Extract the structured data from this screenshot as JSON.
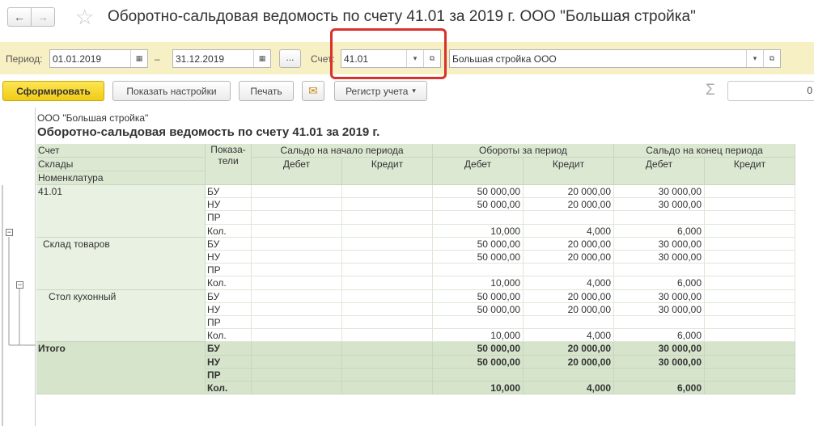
{
  "window": {
    "back_glyph": "←",
    "forward_glyph": "→",
    "favorite_glyph": "☆",
    "title": "Оборотно-сальдовая ведомость по счету 41.01 за 2019 г. ООО \"Большая стройка\""
  },
  "filters": {
    "period_label": "Период:",
    "date_from": "01.01.2019",
    "dash": "–",
    "date_to": "31.12.2019",
    "period_button": "...",
    "account_label": "Счет:",
    "account": "41.01",
    "organization": "Большая стройка ООО",
    "calendar_glyph": "▦",
    "dropdown_glyph": "▾",
    "open_glyph": "⧉"
  },
  "toolbar": {
    "generate": "Сформировать",
    "show_settings": "Показать настройки",
    "print": "Печать",
    "mail_glyph": "✉",
    "register": "Регистр учета",
    "register_arrow": "▾",
    "sigma_glyph": "Σ",
    "sum_value": "0"
  },
  "report": {
    "company": "ООО \"Большая стройка\"",
    "title": "Оборотно-сальдовая ведомость по счету 41.01 за 2019 г.",
    "tree_glyph": "−",
    "headers": {
      "row_labels": [
        "Счет",
        "Склады",
        "Номенклатура"
      ],
      "indicators": "Показа-\nтели",
      "groups": [
        "Сальдо на начало периода",
        "Обороты за период",
        "Сальдо на конец периода"
      ],
      "sub": [
        "Дебет",
        "Кредит",
        "Дебет",
        "Кредит",
        "Дебет",
        "Кредит"
      ]
    },
    "groups": [
      {
        "label": "41.01",
        "level": 0,
        "rows": [
          {
            "ind": "БУ",
            "v": [
              "",
              "",
              "50 000,00",
              "20 000,00",
              "30 000,00",
              ""
            ]
          },
          {
            "ind": "НУ",
            "v": [
              "",
              "",
              "50 000,00",
              "20 000,00",
              "30 000,00",
              ""
            ]
          },
          {
            "ind": "ПР",
            "v": [
              "",
              "",
              "",
              "",
              "",
              ""
            ]
          },
          {
            "ind": "Кол.",
            "v": [
              "",
              "",
              "10,000",
              "4,000",
              "6,000",
              ""
            ]
          }
        ]
      },
      {
        "label": "Склад товаров",
        "level": 1,
        "rows": [
          {
            "ind": "БУ",
            "v": [
              "",
              "",
              "50 000,00",
              "20 000,00",
              "30 000,00",
              ""
            ]
          },
          {
            "ind": "НУ",
            "v": [
              "",
              "",
              "50 000,00",
              "20 000,00",
              "30 000,00",
              ""
            ]
          },
          {
            "ind": "ПР",
            "v": [
              "",
              "",
              "",
              "",
              "",
              ""
            ]
          },
          {
            "ind": "Кол.",
            "v": [
              "",
              "",
              "10,000",
              "4,000",
              "6,000",
              ""
            ]
          }
        ]
      },
      {
        "label": "Стол кухонный",
        "level": 2,
        "rows": [
          {
            "ind": "БУ",
            "v": [
              "",
              "",
              "50 000,00",
              "20 000,00",
              "30 000,00",
              ""
            ]
          },
          {
            "ind": "НУ",
            "v": [
              "",
              "",
              "50 000,00",
              "20 000,00",
              "30 000,00",
              ""
            ]
          },
          {
            "ind": "ПР",
            "v": [
              "",
              "",
              "",
              "",
              "",
              ""
            ]
          },
          {
            "ind": "Кол.",
            "v": [
              "",
              "",
              "10,000",
              "4,000",
              "6,000",
              ""
            ]
          }
        ]
      },
      {
        "label": "Итого",
        "level": "total",
        "rows": [
          {
            "ind": "БУ",
            "v": [
              "",
              "",
              "50 000,00",
              "20 000,00",
              "30 000,00",
              ""
            ]
          },
          {
            "ind": "НУ",
            "v": [
              "",
              "",
              "50 000,00",
              "20 000,00",
              "30 000,00",
              ""
            ]
          },
          {
            "ind": "ПР",
            "v": [
              "",
              "",
              "",
              "",
              "",
              ""
            ]
          },
          {
            "ind": "Кол.",
            "v": [
              "",
              "",
              "10,000",
              "4,000",
              "6,000",
              ""
            ]
          }
        ]
      }
    ]
  },
  "colors": {
    "filter_bar": "#f7f0c4",
    "header_green": "#dde8d3",
    "group_green": "#e9f1e3",
    "total_green": "#d6e4cc",
    "primary_button": "#f1cc16",
    "highlight_frame": "#d9322b"
  }
}
